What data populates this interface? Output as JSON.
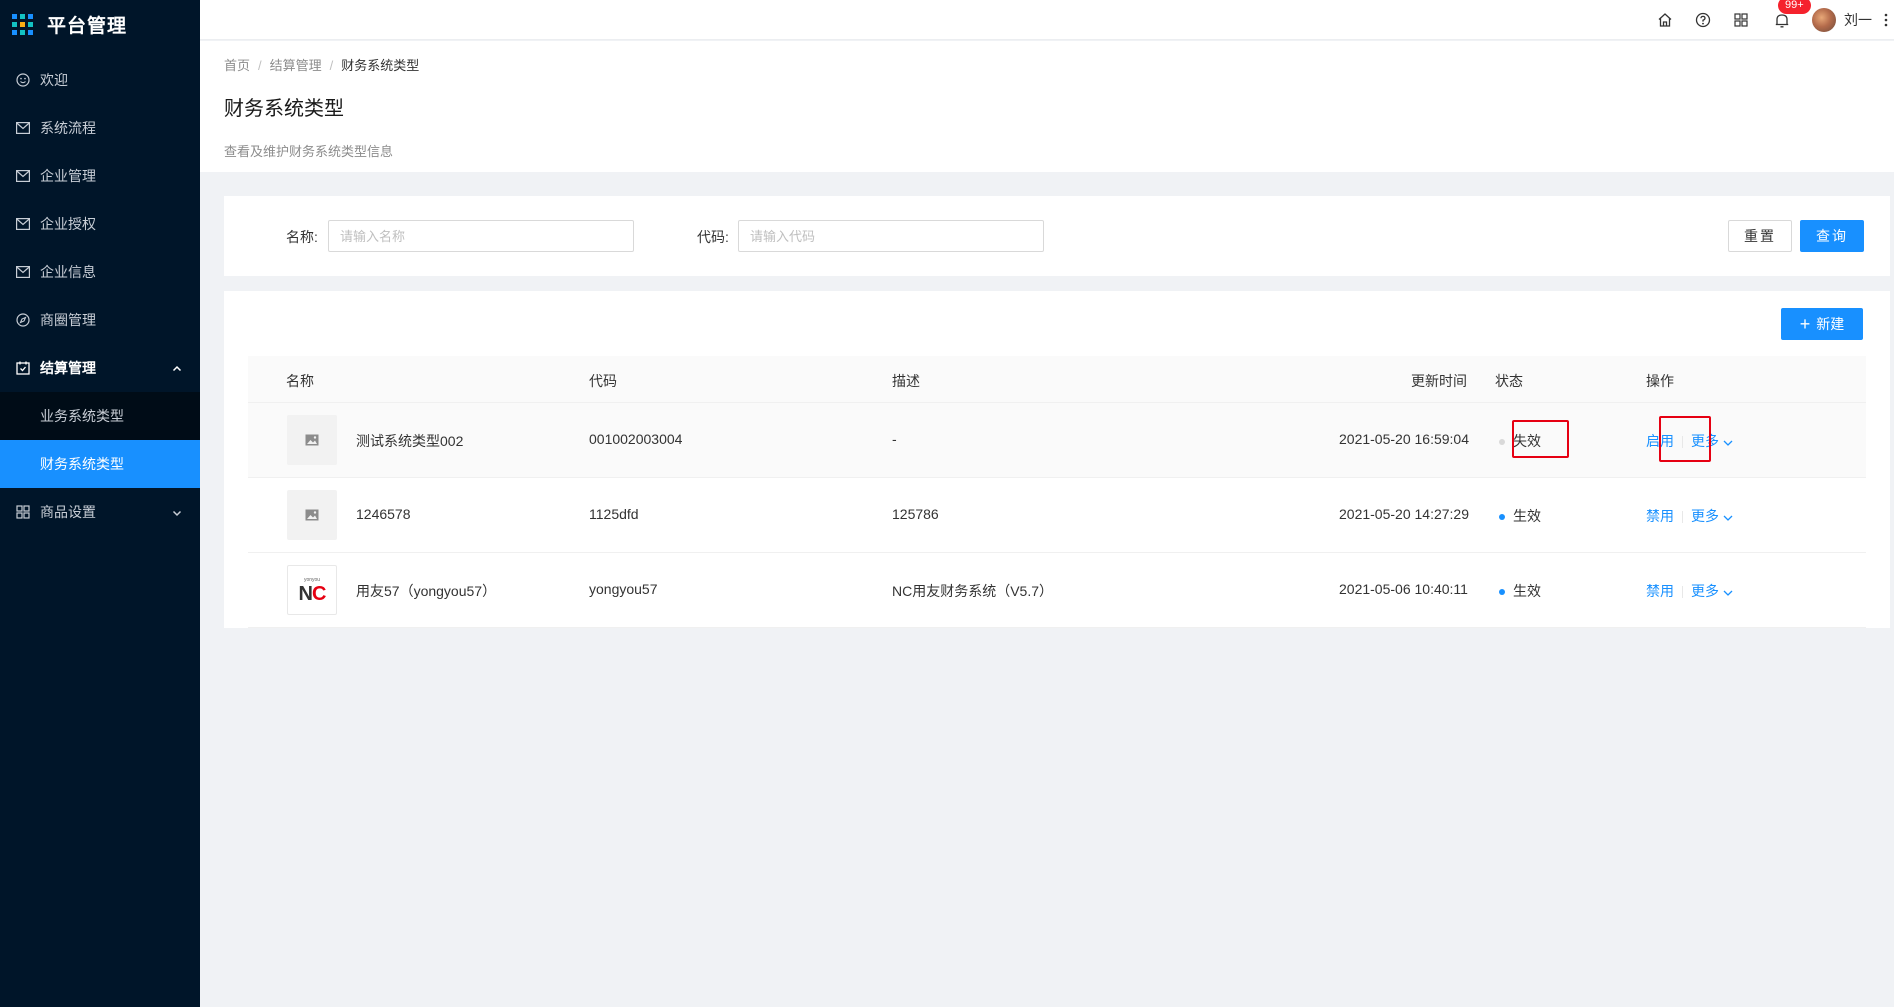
{
  "app": {
    "title": "平台管理"
  },
  "sidebar": {
    "items": [
      {
        "label": "欢迎"
      },
      {
        "label": "系统流程"
      },
      {
        "label": "企业管理"
      },
      {
        "label": "企业授权"
      },
      {
        "label": "企业信息"
      },
      {
        "label": "商圈管理"
      },
      {
        "label": "结算管理"
      },
      {
        "label": "业务系统类型"
      },
      {
        "label": "财务系统类型"
      },
      {
        "label": "商品设置"
      }
    ]
  },
  "header": {
    "badge": "99+",
    "user_name": "刘一"
  },
  "breadcrumb": [
    "首页",
    "结算管理",
    "财务系统类型"
  ],
  "page": {
    "title": "财务系统类型",
    "description": "查看及维护财务系统类型信息"
  },
  "search": {
    "name_label": "名称:",
    "name_placeholder": "请输入名称",
    "code_label": "代码:",
    "code_placeholder": "请输入代码",
    "reset_label": "重置",
    "query_label": "查询"
  },
  "table": {
    "new_label": "新建",
    "columns": [
      "名称",
      "代码",
      "描述",
      "更新时间",
      "状态",
      "操作"
    ],
    "rows": [
      {
        "name": "测试系统类型002",
        "code": "001002003004",
        "desc": "-",
        "updated": "2021-05-20 16:59:04",
        "status": "失效",
        "action": "启用",
        "more": "更多",
        "thumb": "image-placeholder-icon"
      },
      {
        "name": "1246578",
        "code": "1125dfd",
        "desc": "125786",
        "updated": "2021-05-20 14:27:29",
        "status": "生效",
        "action": "禁用",
        "more": "更多",
        "thumb": "image-placeholder-icon"
      },
      {
        "name": "用友57（yongyou57）",
        "code": "yongyou57",
        "desc": "NC用友财务系统（V5.7）",
        "updated": "2021-05-06 10:40:11",
        "status": "生效",
        "action": "禁用",
        "more": "更多",
        "thumb": "nc-logo",
        "logo_small": "yonyou",
        "logo_text": "NC"
      }
    ]
  },
  "colors": {
    "primary": "#1890ff",
    "sidebar": "#001529",
    "highlight": "#e60012"
  }
}
